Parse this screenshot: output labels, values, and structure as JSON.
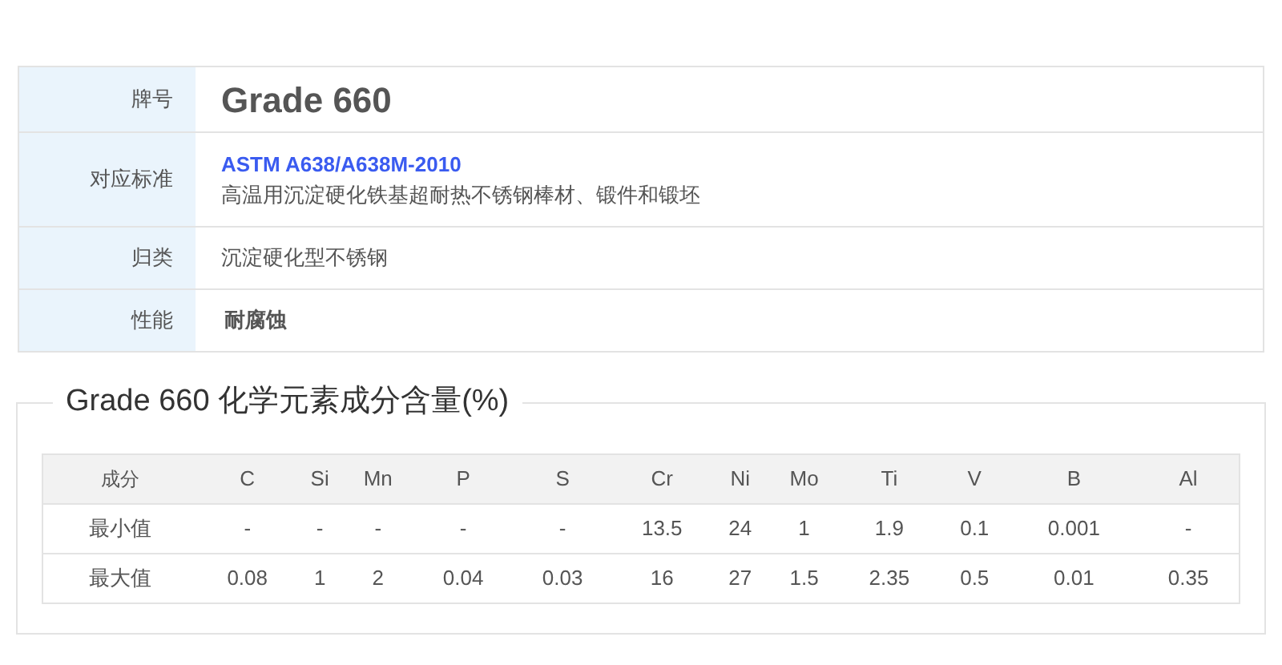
{
  "info": {
    "rows": [
      {
        "kind": "title",
        "label": "牌号",
        "value": "Grade 660"
      },
      {
        "kind": "standard",
        "label": "对应标准",
        "link": "ASTM A638/A638M-2010",
        "value": "高温用沉淀硬化铁基超耐热不锈钢棒材、锻件和锻坯"
      },
      {
        "kind": "plain",
        "label": "归类",
        "value": "沉淀硬化型不锈钢"
      },
      {
        "kind": "bold",
        "label": "性能",
        "value": "耐腐蚀"
      }
    ]
  },
  "composition": {
    "title": "Grade 660 化学元素成分含量(%)",
    "columns": [
      "成分",
      "C",
      "Si",
      "Mn",
      "P",
      "S",
      "Cr",
      "Ni",
      "Mo",
      "Ti",
      "V",
      "B",
      "Al"
    ],
    "rows": [
      [
        "最小值",
        "-",
        "-",
        "-",
        "-",
        "-",
        "13.5",
        "24",
        "1",
        "1.9",
        "0.1",
        "0.001",
        "-"
      ],
      [
        "最大值",
        "0.08",
        "1",
        "2",
        "0.04",
        "0.03",
        "16",
        "27",
        "1.5",
        "2.35",
        "0.5",
        "0.01",
        "0.35"
      ]
    ]
  }
}
